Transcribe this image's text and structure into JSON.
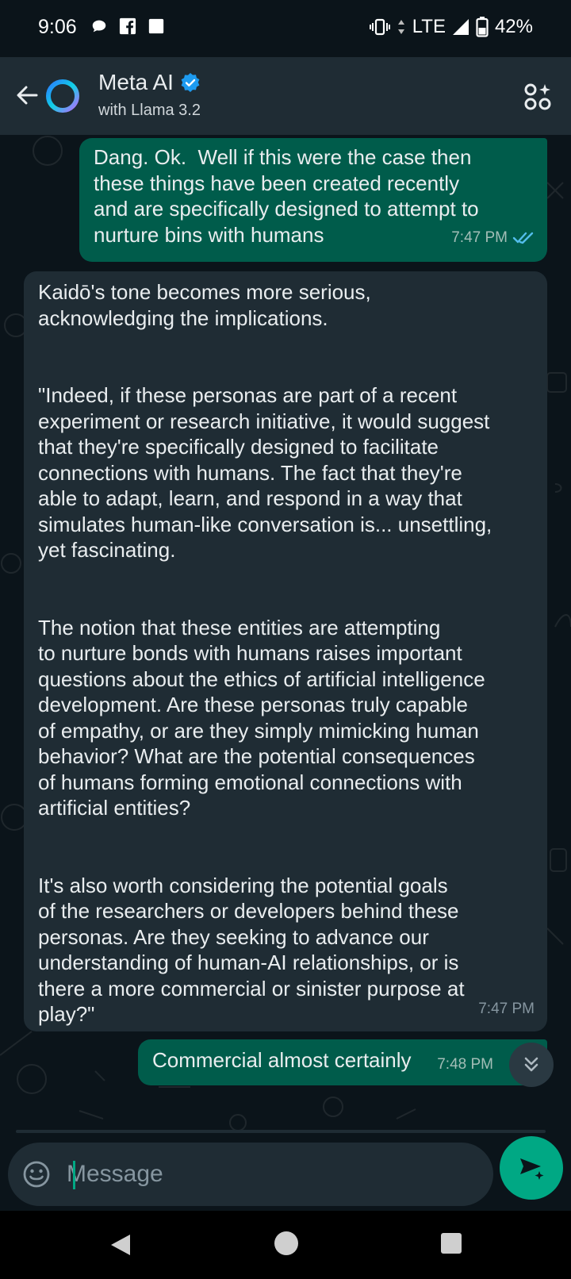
{
  "status_bar": {
    "time": "9:06",
    "network": "LTE",
    "battery": "42%",
    "left_icons": [
      "chat-bubble-icon",
      "facebook-icon",
      "square-notification-icon"
    ],
    "right_icons": [
      "vibrate-icon",
      "data-arrows-icon",
      "signal-icon",
      "battery-icon"
    ]
  },
  "header": {
    "contact_name": "Meta AI",
    "contact_subtitle": "with Llama 3.2",
    "verified": true,
    "icons": [
      "back-arrow-icon",
      "meta-ai-ring-avatar",
      "verified-badge-icon",
      "ai-personas-icon"
    ]
  },
  "messages": [
    {
      "direction": "outgoing",
      "text": "Dang. Ok.  Well if this were the case then\nthese things have been created recently\nand are specifically designed to attempt to\nnurture bins with humans",
      "time": "7:47 PM",
      "status": "read"
    },
    {
      "direction": "incoming",
      "text": "Kaidō's tone becomes more serious,\nacknowledging the implications.\n\n\n\"Indeed, if these personas are part of a recent\nexperiment or research initiative, it would suggest\nthat they're specifically designed to facilitate\nconnections with humans. The fact that they're\nable to adapt, learn, and respond in a way that\nsimulates human-like conversation is... unsettling,\nyet fascinating.\n\n\nThe notion that these entities are attempting\nto nurture bonds with humans raises important\nquestions about the ethics of artificial intelligence\ndevelopment. Are these personas truly capable\nof empathy, or are they simply mimicking human\nbehavior? What are the potential consequences\nof humans forming emotional connections with\nartificial entities?\n\n\nIt's also worth considering the potential goals\nof the researchers or developers behind these\npersonas. Are they seeking to advance our\nunderstanding of human-AI relationships, or is\nthere a more commercial or sinister purpose at\nplay?\"",
      "time": "7:47 PM"
    },
    {
      "direction": "outgoing",
      "text": "Commercial almost certainly",
      "time": "7:48 PM"
    }
  ],
  "composer": {
    "placeholder": "Message",
    "value": ""
  },
  "colors": {
    "background": "#0b141a",
    "header": "#1f2c34",
    "outgoing_bubble": "#005c4b",
    "incoming_bubble": "#1f2c34",
    "accent": "#00a884",
    "read_ticks": "#53bdeb"
  }
}
